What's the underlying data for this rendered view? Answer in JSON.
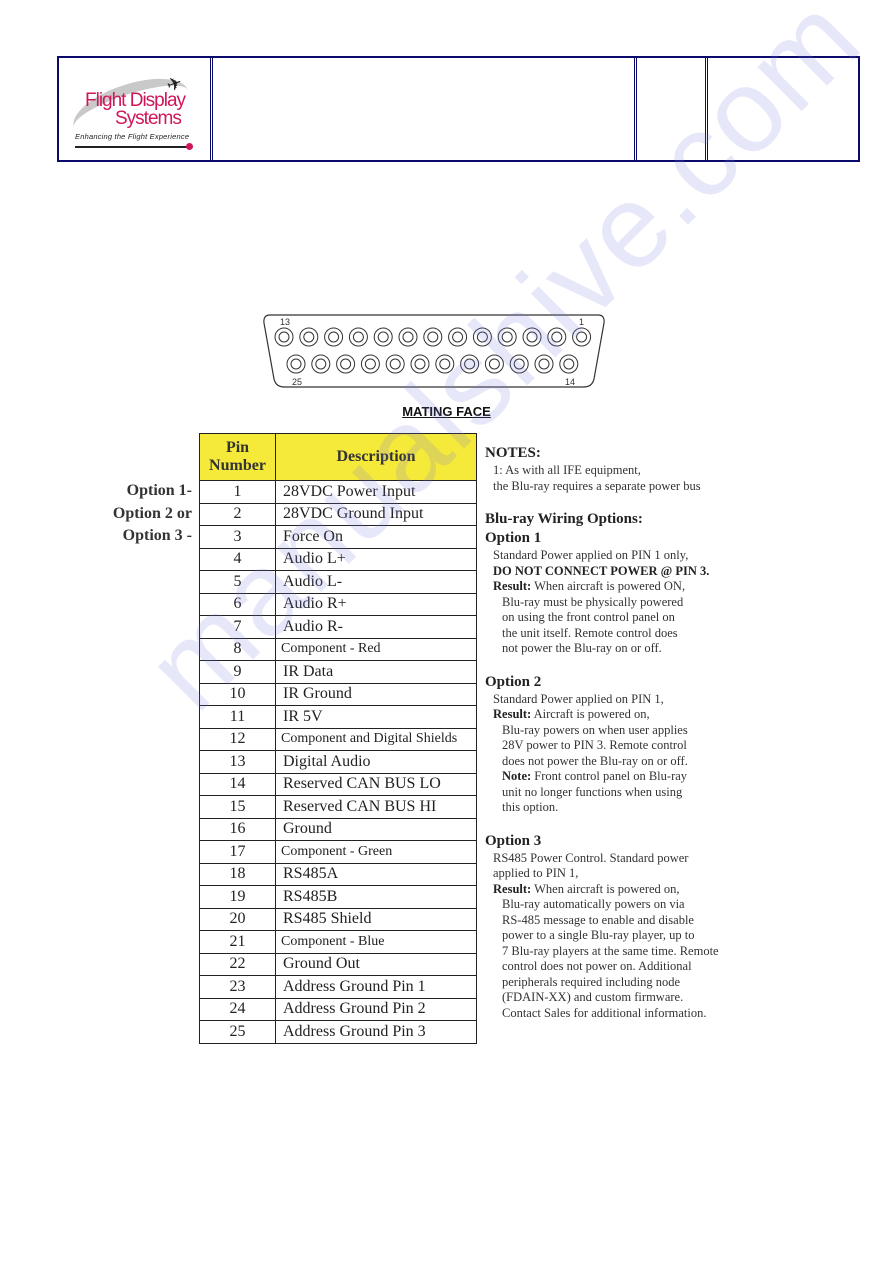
{
  "header": {
    "logo": {
      "line1": "Flight Display",
      "line2": "Systems",
      "tagline": "Enhancing the Flight Experience",
      "brand_color": "#d0165a"
    },
    "cells": [
      "",
      "",
      ""
    ]
  },
  "connector": {
    "top_row_left_label": "13",
    "top_row_right_label": "1",
    "bottom_row_left_label": "25",
    "bottom_row_right_label": "14",
    "top_row_pin_count": 13,
    "bottom_row_pin_count": 12,
    "caption": "MATING FACE"
  },
  "option_labels": [
    "Option 1-",
    "Option 2 or",
    "Option 3 -"
  ],
  "pin_table": {
    "header_color": "#f5e93a",
    "columns": [
      "Pin Number",
      "Description"
    ],
    "column_pin_line1": "Pin",
    "column_pin_line2": "Number",
    "rows": [
      {
        "pin": "1",
        "desc": "28VDC Power Input"
      },
      {
        "pin": "2",
        "desc": "28VDC Ground Input"
      },
      {
        "pin": "3",
        "desc": "Force On"
      },
      {
        "pin": "4",
        "desc": "Audio L+"
      },
      {
        "pin": "5",
        "desc": "Audio L-"
      },
      {
        "pin": "6",
        "desc": "Audio R+"
      },
      {
        "pin": "7",
        "desc": "Audio R-"
      },
      {
        "pin": "8",
        "desc": "Component - Red"
      },
      {
        "pin": "9",
        "desc": "IR Data"
      },
      {
        "pin": "10",
        "desc": "IR Ground"
      },
      {
        "pin": "11",
        "desc": "IR 5V"
      },
      {
        "pin": "12",
        "desc": "Component and Digital Shields"
      },
      {
        "pin": "13",
        "desc": "Digital Audio"
      },
      {
        "pin": "14",
        "desc": "Reserved CAN BUS LO"
      },
      {
        "pin": "15",
        "desc": "Reserved CAN BUS HI"
      },
      {
        "pin": "16",
        "desc": "Ground"
      },
      {
        "pin": "17",
        "desc": "Component - Green"
      },
      {
        "pin": "18",
        "desc": "RS485A"
      },
      {
        "pin": "19",
        "desc": "RS485B"
      },
      {
        "pin": "20",
        "desc": "RS485 Shield"
      },
      {
        "pin": "21",
        "desc": "Component - Blue"
      },
      {
        "pin": "22",
        "desc": "Ground Out"
      },
      {
        "pin": "23",
        "desc": "Address Ground Pin 1"
      },
      {
        "pin": "24",
        "desc": "Address Ground Pin 2"
      },
      {
        "pin": "25",
        "desc": "Address Ground Pin 3"
      }
    ]
  },
  "notes": {
    "title": "NOTES:",
    "note1_line1": "1: As with all IFE equipment,",
    "note1_line2": "the Blu-ray requires a separate power bus",
    "wiring_title": "Blu-ray Wiring Options:",
    "option1": {
      "title": "Option 1",
      "line1": "Standard Power applied on PIN 1 only,",
      "warning": "DO NOT CONNECT POWER @ PIN 3.",
      "result_label": "Result:",
      "result_first": "When aircraft is powered ON,",
      "result_lines": [
        "Blu-ray must be physically powered",
        "on using the front control panel on",
        "the unit itself. Remote control does",
        "not power the Blu-ray on or off."
      ]
    },
    "option2": {
      "title": "Option 2",
      "line1": "Standard Power applied on PIN 1,",
      "result_label": "Result:",
      "result_first": "Aircraft is powered on,",
      "result_lines": [
        "Blu-ray powers on when user applies",
        "28V power to PIN 3. Remote control",
        "does not power the Blu-ray on or off."
      ],
      "note_label": "Note:",
      "note_first": "Front control panel on Blu-ray",
      "note_lines": [
        "unit no longer functions when using",
        "this option."
      ]
    },
    "option3": {
      "title": "Option 3",
      "line1": "RS485 Power Control. Standard power",
      "line2": "applied to PIN 1,",
      "result_label": "Result:",
      "result_first": "When aircraft is powered on,",
      "result_lines": [
        "Blu-ray automatically powers on via",
        "RS-485 message to enable and disable",
        "power to a single Blu-ray player, up to",
        "7 Blu-ray players at the same time. Remote",
        "control does not power on. Additional",
        "peripherals required including node",
        "(FDAIN-XX) and custom firmware.",
        "Contact Sales for additional information."
      ]
    }
  },
  "watermark": "manualshive.com"
}
